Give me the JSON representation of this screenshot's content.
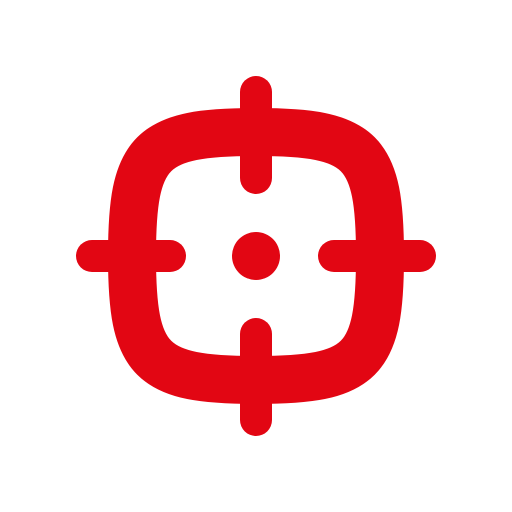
{
  "icon": {
    "name": "crosshair-icon",
    "color": "#e20613",
    "background": "#ffffff"
  }
}
